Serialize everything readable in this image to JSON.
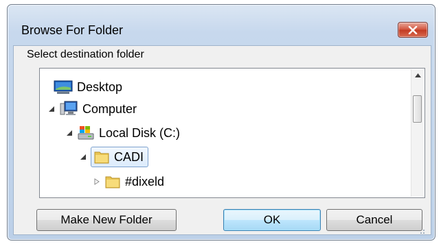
{
  "window": {
    "title": "Browse For Folder",
    "close_icon": "close-icon",
    "close_color": "#c23a22"
  },
  "prompt": "Select destination folder",
  "tree": {
    "items": [
      {
        "label": "Desktop",
        "icon": "desktop-icon",
        "expander": "none"
      },
      {
        "label": "Computer",
        "icon": "computer-icon",
        "expander": "expanded"
      },
      {
        "label": "Local Disk (C:)",
        "icon": "drive-icon",
        "expander": "expanded"
      },
      {
        "label": "CADI",
        "icon": "folder-icon",
        "expander": "expanded",
        "selected": true
      },
      {
        "label": "#dixeld",
        "icon": "folder-icon",
        "expander": "collapsed"
      }
    ]
  },
  "buttons": {
    "make_new_folder": "Make New Folder",
    "ok": "OK",
    "cancel": "Cancel"
  }
}
